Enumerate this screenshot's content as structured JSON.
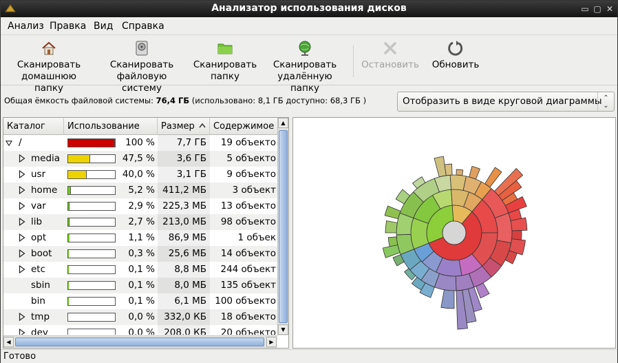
{
  "window": {
    "title": "Анализатор использования дисков"
  },
  "menu": [
    "Анализ",
    "Правка",
    "Вид",
    "Справка"
  ],
  "toolbar": {
    "scan_home": [
      "Сканировать",
      "домашнюю папку"
    ],
    "scan_fs": [
      "Сканировать",
      "файловую систему"
    ],
    "scan_folder": [
      "Сканировать",
      "папку"
    ],
    "scan_remote": [
      "Сканировать",
      "удалённую папку"
    ],
    "stop": "Остановить",
    "refresh": "Обновить"
  },
  "info": {
    "label": "Общая ёмкость файловой системы:",
    "capacity": "76,4 ГБ",
    "detail": "(использовано: 8,1 ГБ доступно: 68,3 ГБ )"
  },
  "view_select": {
    "value": "Отобразить в виде круговой диаграммы"
  },
  "columns": [
    "Каталог",
    "Использование",
    "Размер",
    "Содержимое"
  ],
  "rows": [
    {
      "name": "/",
      "usage": 1.0,
      "color": "#cc0000",
      "pct": "100 %",
      "size": "7,7 ГБ",
      "contents": "19 объекто"
    },
    {
      "name": "media",
      "usage": 0.475,
      "color": "#edd400",
      "pct": "47,5 %",
      "size": "3,6 ГБ",
      "contents": "5 объекто"
    },
    {
      "name": "usr",
      "usage": 0.4,
      "color": "#edd400",
      "pct": "40,0 %",
      "size": "3,1 ГБ",
      "contents": "9 объекто"
    },
    {
      "name": "home",
      "usage": 0.052,
      "color": "#73d216",
      "pct": "5,2 %",
      "size": "411,2 МБ",
      "contents": "3 объект"
    },
    {
      "name": "var",
      "usage": 0.029,
      "color": "#73d216",
      "pct": "2,9 %",
      "size": "225,3 МБ",
      "contents": "13 объекто"
    },
    {
      "name": "lib",
      "usage": 0.027,
      "color": "#73d216",
      "pct": "2,7 %",
      "size": "213,0 МБ",
      "contents": "98 объекто"
    },
    {
      "name": "opt",
      "usage": 0.011,
      "color": "#73d216",
      "pct": "1,1 %",
      "size": "86,9 МБ",
      "contents": "1 объек"
    },
    {
      "name": "boot",
      "usage": 0.003,
      "color": "#73d216",
      "pct": "0,3 %",
      "size": "25,6 МБ",
      "contents": "14 объекто"
    },
    {
      "name": "etc",
      "usage": 0.001,
      "color": "#73d216",
      "pct": "0,1 %",
      "size": "8,8 МБ",
      "contents": "244 объект"
    },
    {
      "name": "sbin",
      "usage": 0.001,
      "color": "#73d216",
      "pct": "0,1 %",
      "size": "8,0 МБ",
      "contents": "135 объект"
    },
    {
      "name": "bin",
      "usage": 0.001,
      "color": "#73d216",
      "pct": "0,1 %",
      "size": "6,1 МБ",
      "contents": "100 объекто"
    },
    {
      "name": "tmp",
      "usage": 0.0,
      "color": "#73d216",
      "pct": "0,0 %",
      "size": "332,0 КБ",
      "contents": "18 объекто"
    },
    {
      "name": "dev",
      "usage": 0.0,
      "color": "#73d216",
      "pct": "0,0 %",
      "size": "208,0 КБ",
      "contents": "20 объекто"
    }
  ],
  "status": "Готово"
}
